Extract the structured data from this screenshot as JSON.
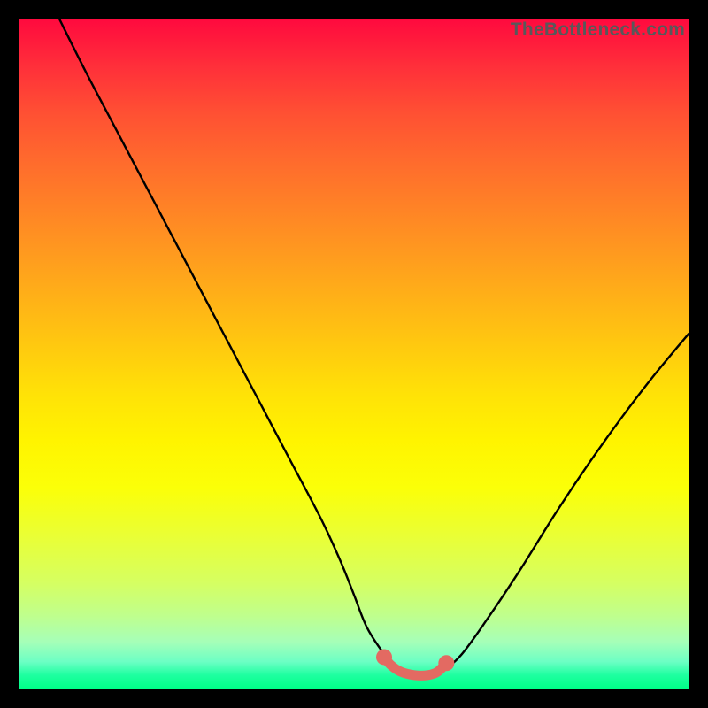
{
  "watermark": "TheBottleneck.com",
  "chart_data": {
    "type": "line",
    "title": "",
    "xlabel": "",
    "ylabel": "",
    "xlim": [
      0,
      100
    ],
    "ylim": [
      0,
      100
    ],
    "grid": false,
    "legend": false,
    "series": [
      {
        "name": "curve",
        "color": "#000000",
        "x": [
          6,
          10,
          15,
          20,
          25,
          30,
          35,
          40,
          45,
          48,
          50,
          52,
          55,
          57,
          59,
          61,
          63,
          66,
          70,
          75,
          80,
          85,
          90,
          95,
          100
        ],
        "y": [
          100,
          92,
          82.5,
          73,
          63.5,
          54,
          44.5,
          35,
          25.5,
          19,
          14,
          9,
          4.5,
          2.5,
          2,
          2,
          2.5,
          5,
          10.5,
          18,
          26,
          33.5,
          40.5,
          47,
          53
        ]
      },
      {
        "name": "optimal-zone",
        "color": "#e36a62",
        "marker": true,
        "x": [
          54.5,
          55.5,
          57,
          59,
          61,
          62.5,
          63.8
        ],
        "y": [
          4.7,
          3.5,
          2.5,
          2,
          2,
          2.5,
          3.8
        ]
      }
    ],
    "background_gradient": {
      "top": "#ff0a3e",
      "bottom": "#00ff88",
      "description": "red-orange-yellow-green vertical gradient"
    }
  }
}
